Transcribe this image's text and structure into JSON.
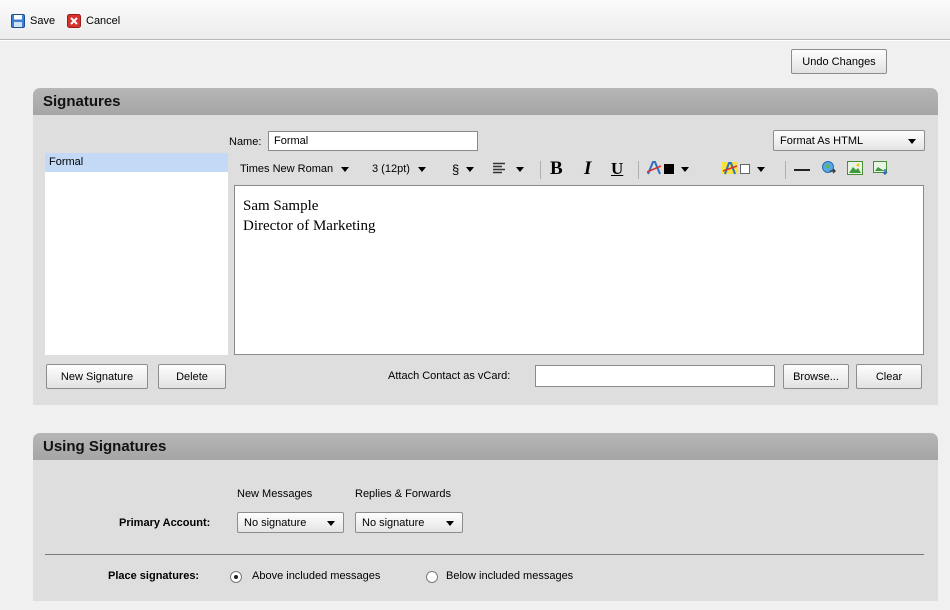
{
  "toolbar": {
    "save_label": "Save",
    "cancel_label": "Cancel"
  },
  "undo_label": "Undo Changes",
  "signatures": {
    "title": "Signatures",
    "name_label": "Name:",
    "name_value": "Formal",
    "format_select": "Format As HTML",
    "list": [
      "Formal"
    ],
    "editor": {
      "font": "Times New Roman",
      "size": "3 (12pt)",
      "style_glyph": "§",
      "bold": "B",
      "italic": "I",
      "underline": "U",
      "lines": [
        "Sam Sample",
        "Director of Marketing"
      ]
    },
    "new_signature_label": "New Signature",
    "delete_label": "Delete",
    "vcard_label": "Attach Contact as vCard:",
    "vcard_value": "",
    "browse_label": "Browse...",
    "clear_label": "Clear"
  },
  "using": {
    "title": "Using Signatures",
    "col_new": "New Messages",
    "col_replies": "Replies & Forwards",
    "primary_label": "Primary Account:",
    "new_select": "No signature",
    "replies_select": "No signature",
    "place_label": "Place signatures:",
    "above_label": "Above included messages",
    "below_label": "Below included messages",
    "selected": "above"
  },
  "colors": {
    "accent": "#2f6fc6",
    "cancel": "#d8322e",
    "list_selected": "#c3d9f5"
  }
}
